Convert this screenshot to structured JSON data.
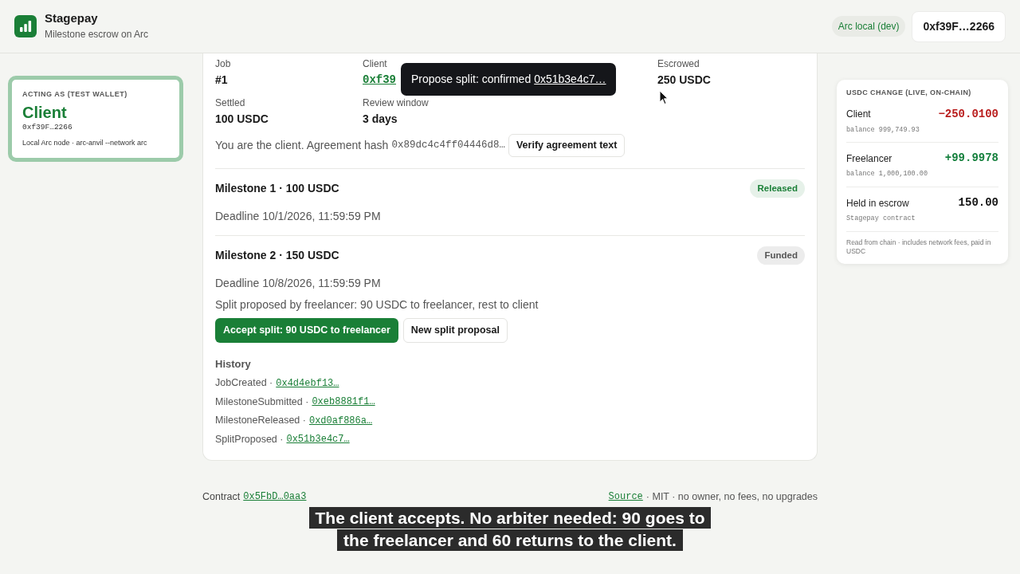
{
  "header": {
    "app_name": "Stagepay",
    "tagline": "Milestone escrow on Arc",
    "network": "Arc local (dev)",
    "wallet": "0xf39F…2266"
  },
  "acting_as": {
    "heading": "ACTING AS (TEST WALLET)",
    "role": "Client",
    "address": "0xf39F…2266",
    "node": "Local Arc node · arc-anvil --network arc"
  },
  "job": {
    "fields": [
      {
        "label": "Job",
        "value": "#1",
        "kind": "text"
      },
      {
        "label": "Client",
        "value": "0xf39",
        "kind": "link"
      },
      {
        "label": "Escrowed",
        "value": "250 USDC",
        "kind": "text"
      },
      {
        "label": "Settled",
        "value": "100 USDC",
        "kind": "text"
      },
      {
        "label": "Review window",
        "value": "3 days",
        "kind": "text"
      }
    ],
    "agreement_text": "You are the client. Agreement hash",
    "agreement_hash": "0x89dc4c4ff04446d8…",
    "verify_button": "Verify agreement text"
  },
  "milestones": [
    {
      "title": "Milestone 1 · 100 USDC",
      "status": "Released",
      "color": "#1a7f37",
      "deadline": "Deadline 10/1/2026, 11:59:59 PM"
    },
    {
      "title": "Milestone 2 · 150 USDC",
      "status": "Funded",
      "color": "#555555",
      "deadline": "Deadline 10/8/2026, 11:59:59 PM",
      "proposal": "Split proposed by freelancer: 90 USDC to freelancer, rest to client",
      "accept_button": "Accept split: 90 USDC to freelancer",
      "new_button": "New split proposal"
    }
  ],
  "history": {
    "heading": "History",
    "events": [
      {
        "name": "JobCreated ·",
        "tx": "0x4d4ebf13…"
      },
      {
        "name": "MilestoneSubmitted ·",
        "tx": "0xeb8881f1…"
      },
      {
        "name": "MilestoneReleased ·",
        "tx": "0xd0af886a…"
      },
      {
        "name": "SplitProposed ·",
        "tx": "0x51b3e4c7…"
      }
    ]
  },
  "toast": {
    "text": "Propose split: confirmed",
    "tx": "0x51b3e4c7…"
  },
  "usdc_panel": {
    "heading": "USDC CHANGE (LIVE, ON-CHAIN)",
    "rows": [
      {
        "label": "Client",
        "amount": "−250.0100",
        "sub": "balance 999,749.93",
        "color": "#b91c1c"
      },
      {
        "label": "Freelancer",
        "amount": "+99.9978",
        "sub": "balance 1,000,100.00",
        "color": "#15803d"
      },
      {
        "label": "Held in escrow",
        "amount": "150.00",
        "sub": "Stagepay contract",
        "color": "#111111"
      }
    ],
    "note": "Read from chain · includes network fees, paid in USDC"
  },
  "footer": {
    "contract_label": "Contract",
    "contract": "0x5FbD…0aa3",
    "source_link": "Source",
    "license": "· MIT · no owner, no fees, no upgrades"
  },
  "caption": "The client accepts. No arbiter needed: 90 goes to the freelancer and 60 returns to the client."
}
